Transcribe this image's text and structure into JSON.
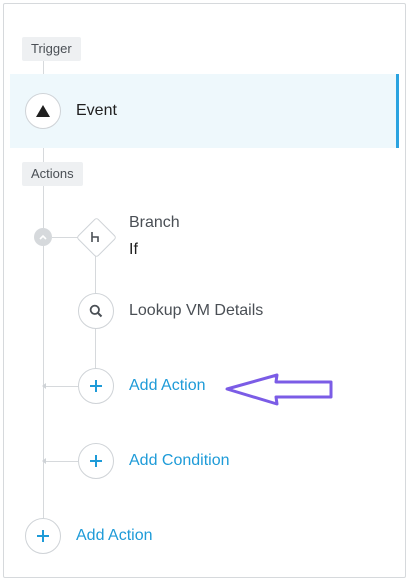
{
  "trigger": {
    "section_label": "Trigger",
    "event_label": "Event"
  },
  "actions": {
    "section_label": "Actions",
    "branch": {
      "title": "Branch",
      "subtitle": "If"
    },
    "lookup": {
      "label": "Lookup VM Details"
    },
    "add_action_inner": "Add Action",
    "add_condition": "Add Condition",
    "add_action_outer": "Add Action"
  },
  "colors": {
    "accent": "#1e9bd8",
    "annotation_arrow": "#7b5ce6",
    "selected_bg": "#eef8fc"
  }
}
